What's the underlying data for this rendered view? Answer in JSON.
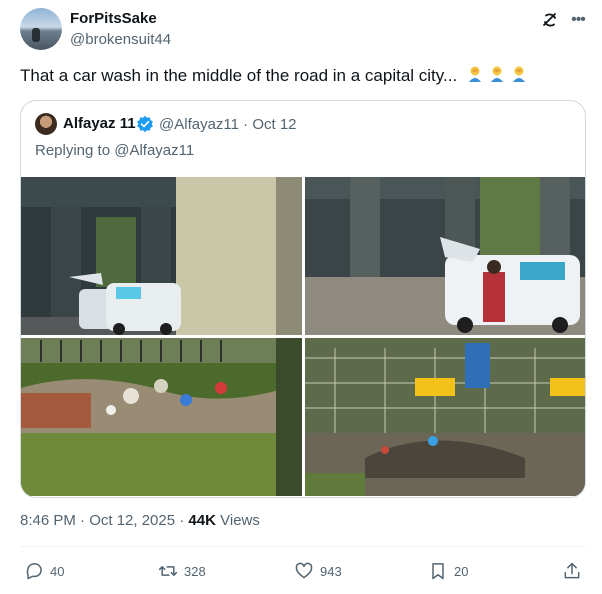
{
  "author": {
    "display_name": "ForPitsSake",
    "handle": "@brokensuit44"
  },
  "tweet": {
    "text": "That a car wash in the middle of the road in a capital city...",
    "emojis": [
      "person-facepalming-icon",
      "person-facepalming-icon",
      "person-facepalming-icon"
    ]
  },
  "quoted": {
    "display_name": "Alfayaz 11",
    "handle_date": "@Alfayaz11 · Oct 12",
    "reply_prefix": "Replying to",
    "reply_mention": "@Alfayaz11",
    "images": [
      "car-under-flyover-photo",
      "open-trunk-car-photo",
      "roadside-garbage-photo",
      "fenced-garbage-area-photo"
    ]
  },
  "meta": {
    "time_date": "8:46 PM · Oct 12, 2025 ·",
    "views_count": "44K",
    "views_label": "Views"
  },
  "actions": {
    "replies": "40",
    "reposts": "328",
    "likes": "943",
    "bookmarks": "20"
  },
  "colors": {
    "text_primary": "#0f1419",
    "text_secondary": "#536471",
    "verified_blue": "#1d9bf0",
    "border": "#cfd9de"
  }
}
